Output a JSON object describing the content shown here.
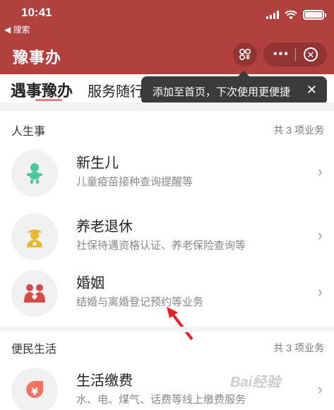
{
  "status_bar": {
    "time": "10:41",
    "back_label": "◀ 搜索"
  },
  "header": {
    "title": "豫事办"
  },
  "tabs": [
    {
      "label": "遇事豫办"
    },
    {
      "label": "服务随行"
    }
  ],
  "tooltip": {
    "text": "添加至首页，下次使用更便捷",
    "close": "✕"
  },
  "sections": [
    {
      "title": "人生事",
      "count": "共 3 项业务",
      "items": [
        {
          "title": "新生儿",
          "desc": "儿童疫苗接种查询提醒等",
          "icon": "baby-icon"
        },
        {
          "title": "养老退休",
          "desc": "社保待遇资格认证、养老保险查询等",
          "icon": "elder-icon"
        },
        {
          "title": "婚姻",
          "desc": "结婚与离婚登记预约等业务",
          "icon": "marriage-icon"
        }
      ]
    },
    {
      "title": "便民生活",
      "count": "共 3 项业务",
      "items": [
        {
          "title": "生活缴费",
          "desc": "水、电、煤气、话费等线上缴费服务",
          "icon": "payment-icon"
        }
      ]
    }
  ],
  "colors": {
    "brand": "#b2403f",
    "icon_green": "#4cc7a0",
    "icon_yellow": "#e6b836",
    "icon_red": "#d84a44",
    "icon_orange": "#f2745f"
  },
  "watermark": "Bai经验"
}
